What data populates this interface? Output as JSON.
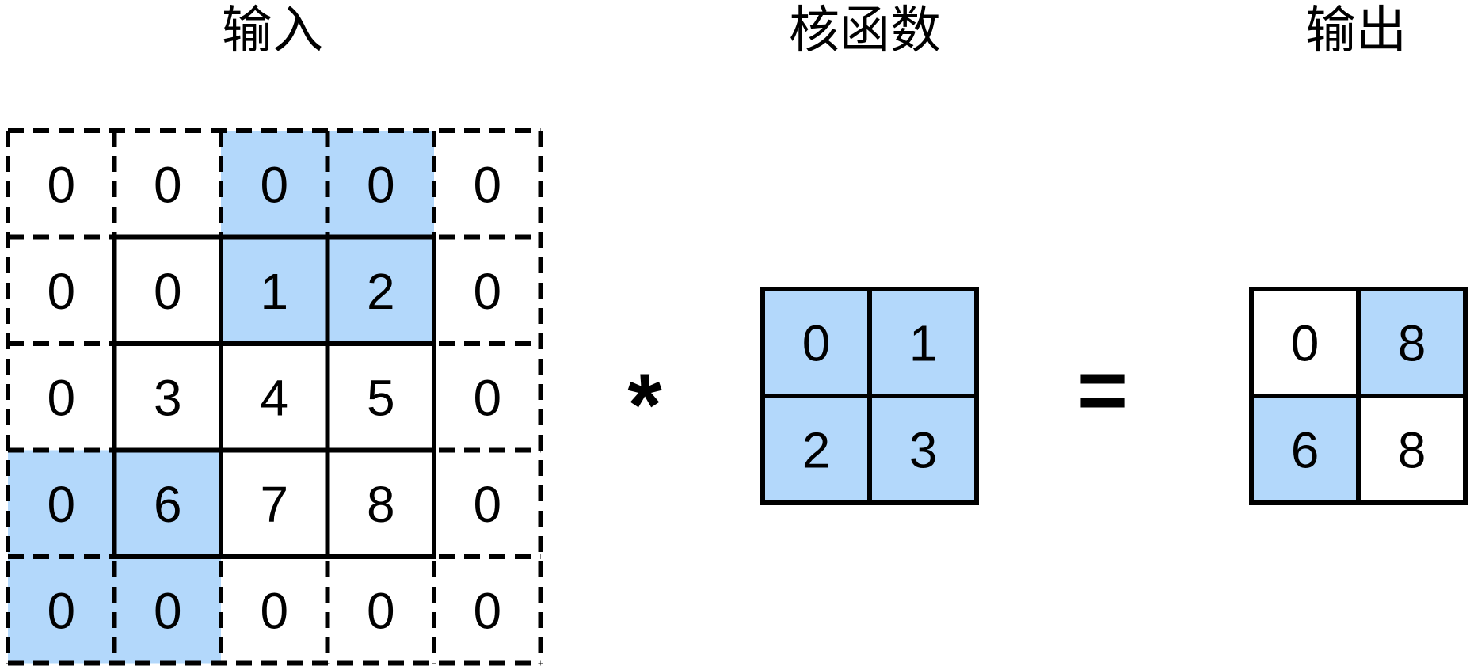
{
  "titles": {
    "input": "输入",
    "kernel": "核函数",
    "output": "输出"
  },
  "operators": {
    "convolve": "*",
    "equals": "="
  },
  "colors": {
    "highlight": "#b3d8fb",
    "stroke": "#000000",
    "background": "#ffffff"
  },
  "input": {
    "padding": 1,
    "values": [
      [
        0,
        0,
        0,
        0,
        0
      ],
      [
        0,
        0,
        1,
        2,
        0
      ],
      [
        0,
        3,
        4,
        5,
        0
      ],
      [
        0,
        6,
        7,
        8,
        0
      ],
      [
        0,
        0,
        0,
        0,
        0
      ]
    ],
    "highlighted": [
      [
        false,
        false,
        true,
        true,
        false
      ],
      [
        false,
        false,
        true,
        true,
        false
      ],
      [
        false,
        false,
        false,
        false,
        false
      ],
      [
        true,
        true,
        false,
        false,
        false
      ],
      [
        true,
        true,
        false,
        false,
        false
      ]
    ]
  },
  "kernel": {
    "values": [
      [
        0,
        1
      ],
      [
        2,
        3
      ]
    ],
    "highlighted": [
      [
        true,
        true
      ],
      [
        true,
        true
      ]
    ]
  },
  "output": {
    "values": [
      [
        0,
        8
      ],
      [
        6,
        8
      ]
    ],
    "highlighted": [
      [
        false,
        true
      ],
      [
        true,
        false
      ]
    ]
  }
}
